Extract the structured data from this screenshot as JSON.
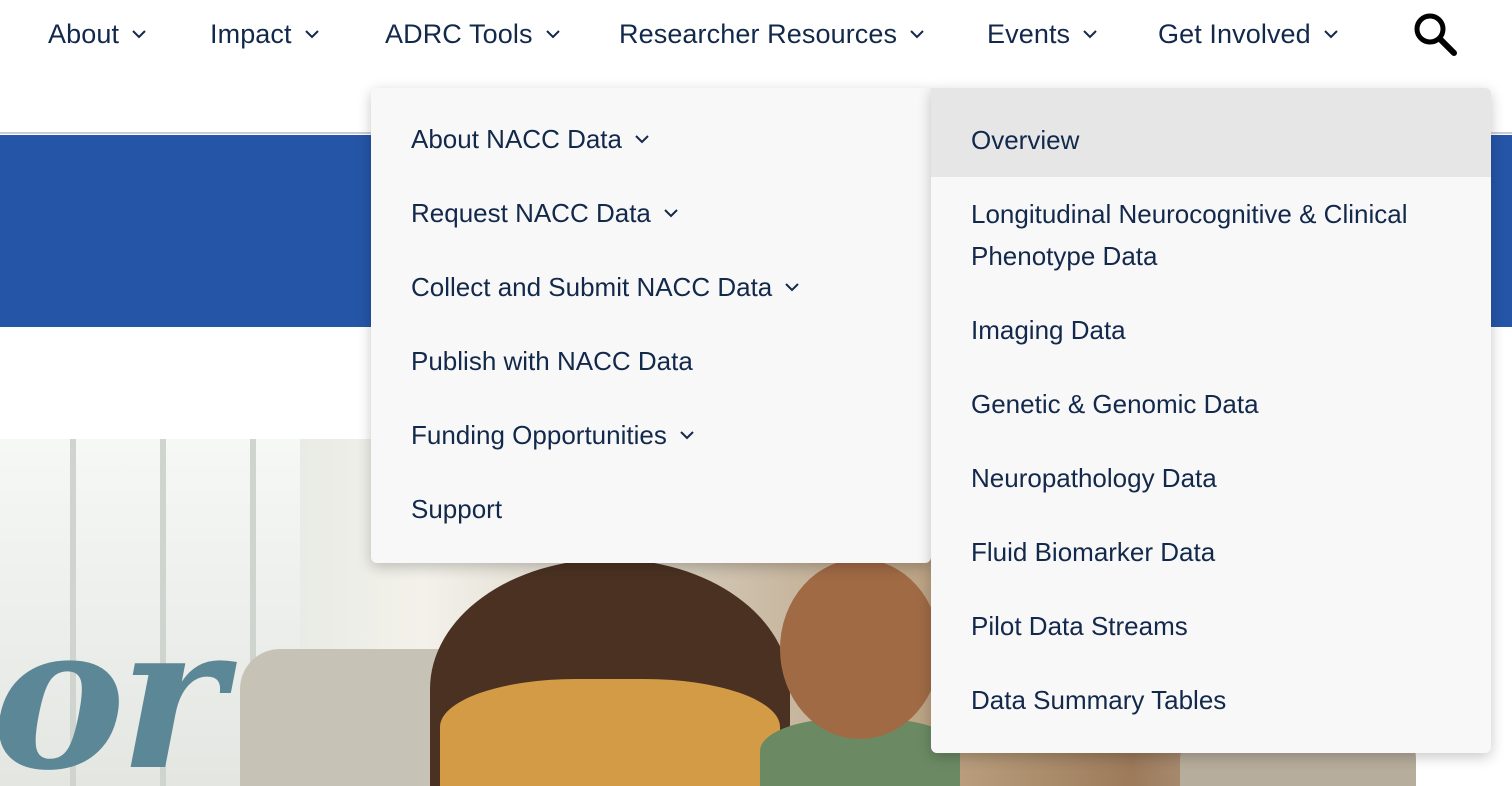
{
  "nav": {
    "items": [
      {
        "label": "About"
      },
      {
        "label": "Impact"
      },
      {
        "label": "ADRC Tools"
      },
      {
        "label": "Researcher Resources"
      },
      {
        "label": "Events"
      },
      {
        "label": "Get Involved"
      }
    ],
    "search_icon": "search-icon"
  },
  "dropdown": {
    "items": [
      {
        "label": "About NACC Data",
        "has_submenu": true
      },
      {
        "label": "Request NACC Data",
        "has_submenu": true
      },
      {
        "label": "Collect and Submit NACC Data",
        "has_submenu": true
      },
      {
        "label": "Publish with NACC Data",
        "has_submenu": false
      },
      {
        "label": "Funding Opportunities",
        "has_submenu": true
      },
      {
        "label": "Support",
        "has_submenu": false
      }
    ]
  },
  "submenu": {
    "items": [
      {
        "label": "Overview",
        "highlighted": true
      },
      {
        "label": "Longitudinal Neurocognitive & Clinical Phenotype Data"
      },
      {
        "label": "Imaging Data"
      },
      {
        "label": "Genetic & Genomic Data"
      },
      {
        "label": "Neuropathology Data"
      },
      {
        "label": "Fluid Biomarker Data"
      },
      {
        "label": "Pilot Data Streams"
      },
      {
        "label": "Data Summary Tables"
      }
    ]
  },
  "hero": {
    "word": "or"
  },
  "colors": {
    "nav_text": "#13294b",
    "blue_band": "#2555a7",
    "hero_word": "#5b8796",
    "menu_bg": "#f8f8f8",
    "menu_highlight": "#e6e6e6"
  }
}
